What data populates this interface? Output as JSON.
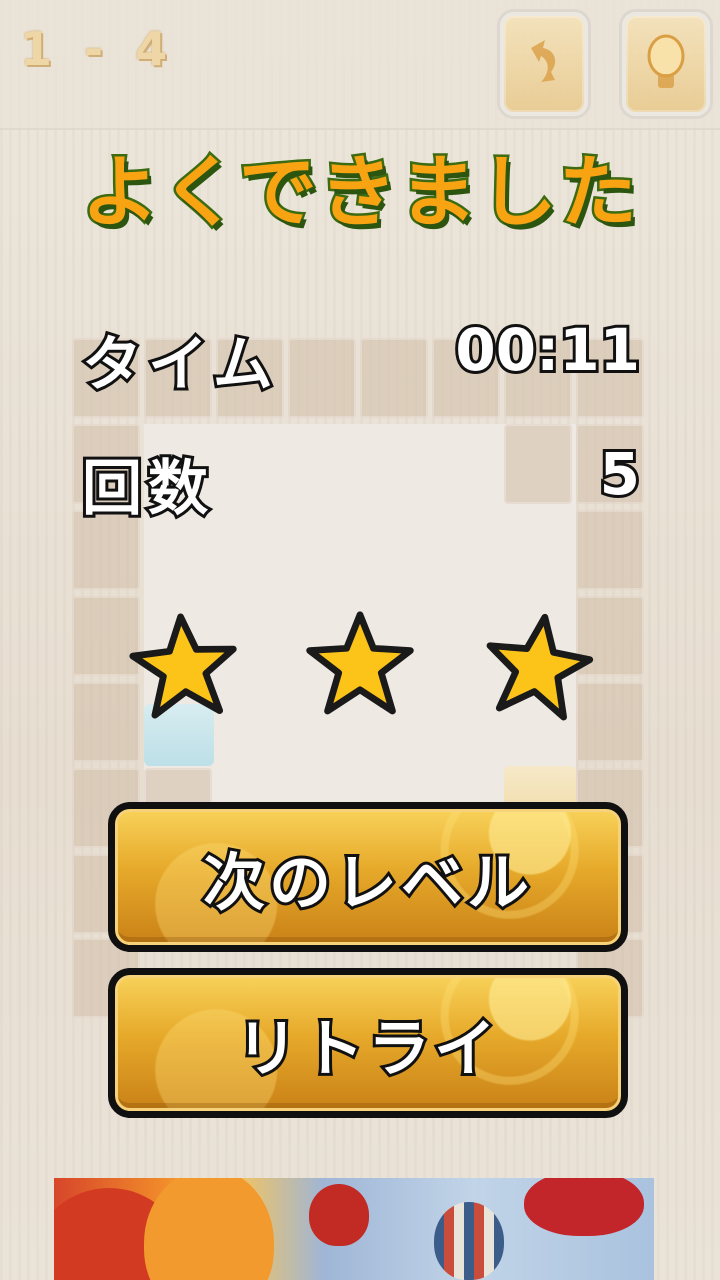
{
  "header": {
    "level": "1 - 4",
    "undo_icon": "undo-arrow-icon",
    "hint_icon": "lightbulb-icon"
  },
  "result": {
    "title": "よくできました",
    "time_label": "タイム",
    "time_value": "00:11",
    "moves_label": "回数",
    "moves_value": "5",
    "stars_earned": 3,
    "stars_total": 3
  },
  "buttons": {
    "next_level": "次のレベル",
    "retry": "リトライ"
  },
  "colors": {
    "title_fill": "#f7a312",
    "title_stroke": "#3c6b12",
    "star_fill": "#fcc419",
    "button_gold": "#e6a92a"
  }
}
